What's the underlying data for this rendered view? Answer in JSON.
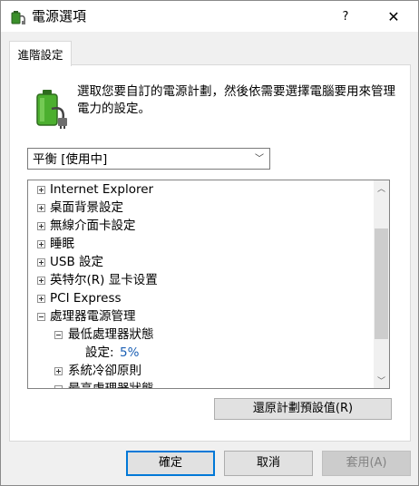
{
  "window": {
    "title": "電源選項",
    "help_label": "?",
    "close_label": "✕"
  },
  "tab": {
    "label": "進階設定"
  },
  "description": "選取您要自訂的電源計劃，然後依需要選擇電腦要用來管理電力的設定。",
  "plan_select": {
    "selected": "平衡 [使用中]"
  },
  "tree": {
    "items": [
      {
        "label": "Internet Explorer",
        "expander": "plus",
        "level": 0
      },
      {
        "label": "桌面背景設定",
        "expander": "plus",
        "level": 0
      },
      {
        "label": "無線介面卡設定",
        "expander": "plus",
        "level": 0
      },
      {
        "label": "睡眠",
        "expander": "plus",
        "level": 0
      },
      {
        "label": "USB 設定",
        "expander": "plus",
        "level": 0
      },
      {
        "label": "英特尔(R) 显卡设置",
        "expander": "plus",
        "level": 0
      },
      {
        "label": "PCI Express",
        "expander": "plus",
        "level": 0
      },
      {
        "label": "處理器電源管理",
        "expander": "minus",
        "level": 0
      },
      {
        "label": "最低處理器狀態",
        "expander": "minus",
        "level": 1
      },
      {
        "label": "設定:",
        "value": "5%",
        "level": 2
      },
      {
        "label": "系統冷卻原則",
        "expander": "plus",
        "level": 1
      },
      {
        "label": "最高處理器狀態",
        "expander": "minus",
        "level": 1
      }
    ]
  },
  "buttons": {
    "restore": "還原計劃預設值(R)",
    "ok": "確定",
    "cancel": "取消",
    "apply": "套用(A)"
  },
  "icons": {
    "window_icon": "power-options-icon",
    "battery": "battery-power-icon",
    "dropdown": "chevron-down-icon",
    "scroll_up": "scroll-up-icon",
    "scroll_down": "scroll-down-icon"
  },
  "colors": {
    "setting_value": "#1a5fb4",
    "ok_border": "#0078d7"
  }
}
